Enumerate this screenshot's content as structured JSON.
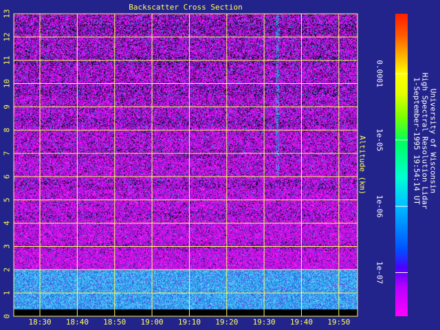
{
  "chart_data": {
    "type": "heatmap",
    "title": "Backscatter Cross Section",
    "xlabel": "",
    "ylabel": "Altitude (km)",
    "x_tick_labels": [
      "18:30",
      "18:40",
      "18:50",
      "19:00",
      "19:10",
      "19:20",
      "19:30",
      "19:40",
      "19:50"
    ],
    "x_ticks_minutes": [
      1110,
      1120,
      1130,
      1140,
      1150,
      1160,
      1170,
      1180,
      1190
    ],
    "xlim_minutes": [
      1103,
      1195
    ],
    "y_tick_labels": [
      "0",
      "1",
      "2",
      "3",
      "4",
      "5",
      "6",
      "7",
      "8",
      "9",
      "10",
      "11",
      "12",
      "13"
    ],
    "ylim": [
      0,
      13
    ],
    "grid": true,
    "colorbar": {
      "scale": "log",
      "range": [
        2.2e-08,
        0.0008
      ],
      "tick_labels": [
        "1e-07",
        "1e-06",
        "1e-05",
        "0.0001"
      ],
      "tick_values": [
        1e-07,
        1e-06,
        1e-05,
        0.0001
      ]
    },
    "regions": [
      {
        "from_km": 0.0,
        "to_km": 0.3,
        "level": "lowest-black"
      },
      {
        "from_km": 0.3,
        "to_km": 2.0,
        "level": "approx 1e-07 (blue, aerosol boundary layer)"
      },
      {
        "from_km": 2.0,
        "to_km": 13.0,
        "level": "approx 3e-08 (magenta/purple, noisy)"
      }
    ],
    "credits": [
      "University of Wisconsin",
      "High Spectral Resolution Lidar",
      "1-September-1995 19:54:14 UT"
    ]
  },
  "colors": {
    "background": "#23238c",
    "grid": "#ffff5a",
    "text": "#ffff5a",
    "credit_text": "#ffffff"
  }
}
